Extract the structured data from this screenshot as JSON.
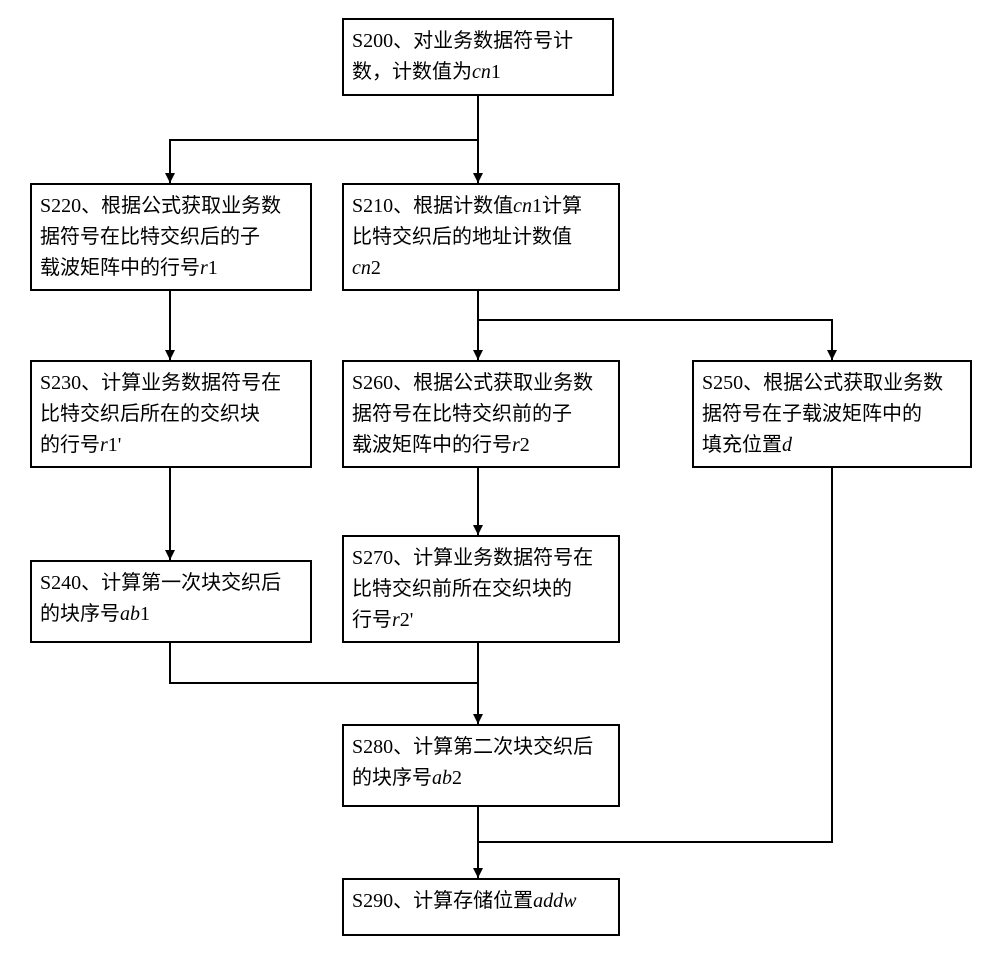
{
  "flow": {
    "s200": {
      "line1": "S200、对业务数据符号计",
      "line2_a": "数，计数值为",
      "cn1": "cn",
      "one": "1"
    },
    "s210": {
      "line1_a": "S210、根据计数值",
      "line1_cn": "cn",
      "line1_one": "1",
      "line1_b": "计算",
      "line2": "比特交织后的地址计数值",
      "cn2": "cn",
      "two": "2"
    },
    "s220": {
      "line1": "S220、根据公式获取业务数",
      "line2": "据符号在比特交织后的子",
      "line3_a": "载波矩阵中的行号",
      "r": "r",
      "one": "1"
    },
    "s230": {
      "line1": "S230、计算业务数据符号在",
      "line2": "比特交织后所在的交织块",
      "line3_a": "的行号",
      "r": "r",
      "one_prime": "1'"
    },
    "s240": {
      "line1": "S240、计算第一次块交织后",
      "line2_a": "的块序号",
      "ab": "ab",
      "one": "1"
    },
    "s250": {
      "line1": "S250、根据公式获取业务数",
      "line2": "据符号在子载波矩阵中的",
      "line3_a": "填充位置",
      "d": "d"
    },
    "s260": {
      "line1": "S260、根据公式获取业务数",
      "line2": "据符号在比特交织前的子",
      "line3_a": "载波矩阵中的行号",
      "r": "r",
      "two": "2"
    },
    "s270": {
      "line1": "S270、计算业务数据符号在",
      "line2": "比特交织前所在交织块的",
      "line3_a": "行号",
      "r": "r",
      "two_prime": "2'"
    },
    "s280": {
      "line1": "S280、计算第二次块交织后",
      "line2_a": "的块序号",
      "ab": "ab",
      "two": "2"
    },
    "s290": {
      "line1_a": "S290、计算存储位置",
      "addw": "addw"
    }
  }
}
